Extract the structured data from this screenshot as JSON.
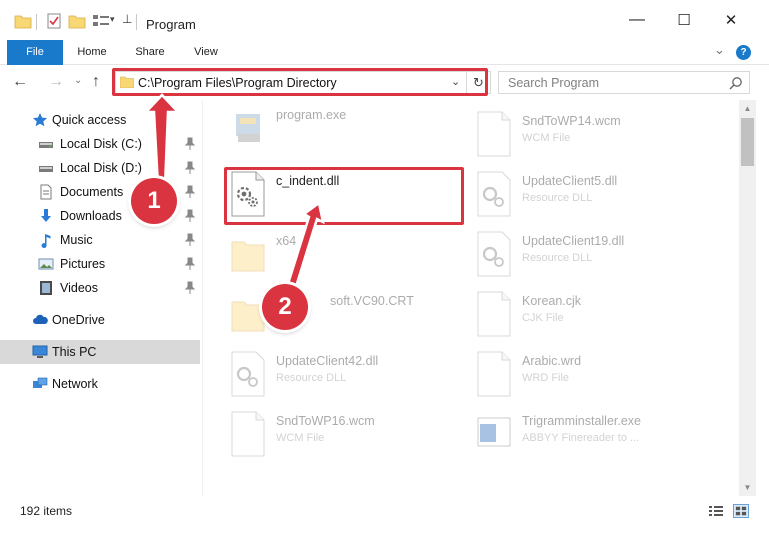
{
  "window": {
    "title": "Program",
    "minimize_glyph": "—",
    "maximize_glyph": "☐",
    "close_glyph": "✕"
  },
  "ribbon": {
    "tabs": [
      "File",
      "Home",
      "Share",
      "View"
    ],
    "expand_glyph": "⌄",
    "help_glyph": "?"
  },
  "nav": {
    "back_glyph": "←",
    "forward_glyph": "→",
    "recent_glyph": "⌄",
    "up_glyph": "↑",
    "address": "C:\\Program Files\\Program Directory",
    "dropdown_glyph": "⌄",
    "refresh_glyph": "↻",
    "search_placeholder": "Search Program"
  },
  "sidebar": {
    "items": [
      {
        "label": "Quick access",
        "icon": "star-icon"
      },
      {
        "label": "Local Disk (C:)",
        "icon": "drive-icon"
      },
      {
        "label": "Local Disk (D:)",
        "icon": "drive-icon"
      },
      {
        "label": "Documents",
        "icon": "documents-icon"
      },
      {
        "label": "Downloads",
        "icon": "download-icon"
      },
      {
        "label": "Music",
        "icon": "music-icon"
      },
      {
        "label": "Pictures",
        "icon": "pictures-icon"
      },
      {
        "label": "Videos",
        "icon": "videos-icon"
      },
      {
        "label": "OneDrive",
        "icon": "cloud-icon"
      },
      {
        "label": "This PC",
        "icon": "computer-icon"
      },
      {
        "label": "Network",
        "icon": "network-icon"
      }
    ]
  },
  "files": {
    "left": [
      {
        "name": "program.exe",
        "type": ""
      },
      {
        "name": "c_indent.dll",
        "type": ""
      },
      {
        "name": "x64",
        "type": ""
      },
      {
        "name": "soft.VC90.CRT",
        "type": ""
      },
      {
        "name": "UpdateClient42.dll",
        "type": "Resource DLL"
      },
      {
        "name": "SndToWP16.wcm",
        "type": "WCM File"
      }
    ],
    "right": [
      {
        "name": "SndToWP14.wcm",
        "type": "WCM File"
      },
      {
        "name": "UpdateClient5.dll",
        "type": "Resource DLL"
      },
      {
        "name": "UpdateClient19.dll",
        "type": "Resource DLL"
      },
      {
        "name": "Korean.cjk",
        "type": "CJK File"
      },
      {
        "name": "Arabic.wrd",
        "type": "WRD File"
      },
      {
        "name": "Trigramminstaller.exe",
        "type": "ABBYY Finereader to ..."
      }
    ]
  },
  "status": {
    "item_count": "192 items"
  },
  "callouts": [
    "1",
    "2"
  ],
  "colors": {
    "accent": "#1979ca",
    "highlight": "#d9343f",
    "folder": "#f8d775"
  }
}
